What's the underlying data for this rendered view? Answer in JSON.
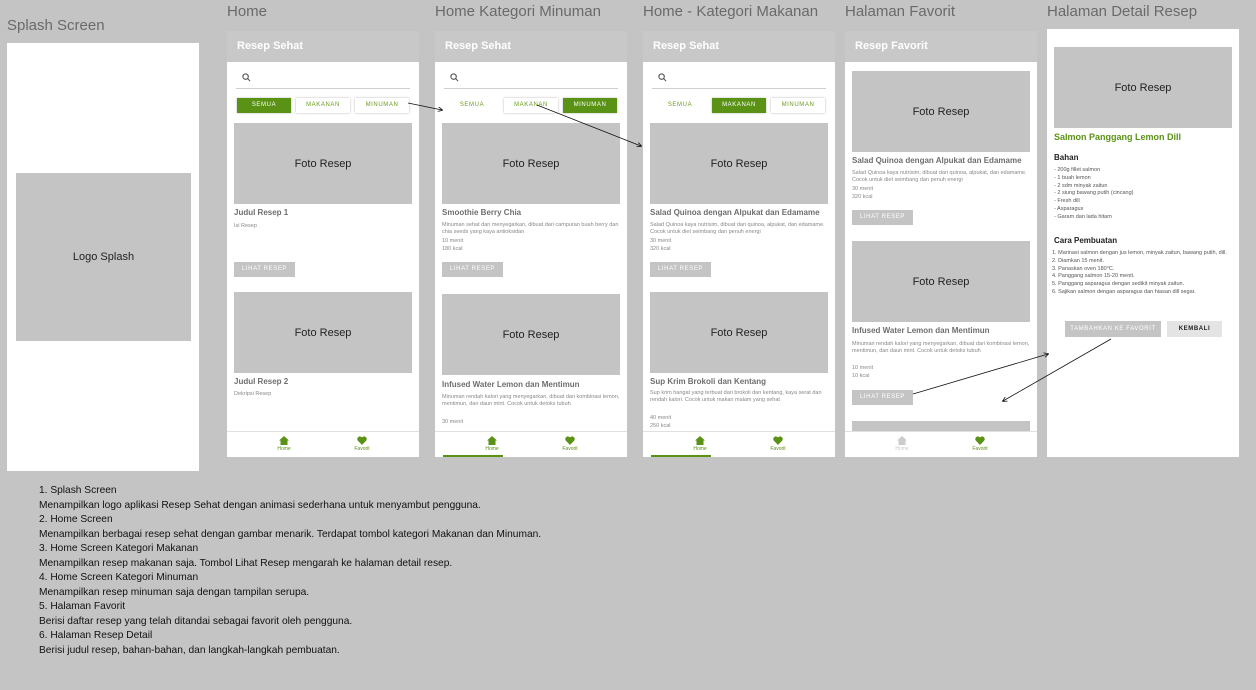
{
  "titles": {
    "splash": "Splash Screen",
    "home": "Home",
    "minuman": "Home Kategori Minuman",
    "makanan": "Home - Kategori Makanan",
    "favorit": "Halaman Favorit",
    "detail": "Halaman Detail Resep"
  },
  "splash": {
    "logo": "Logo Splash"
  },
  "app": {
    "appbar": "Resep Sehat",
    "chips": [
      "SEMUA",
      "MAKANAN",
      "MINUMAN"
    ],
    "nav_home": "Home",
    "nav_fav": "Favorit",
    "photo": "Foto Resep",
    "btn": "LIHAT RESEP"
  },
  "home": {
    "r1_title": "Judul Resep 1",
    "r1_desc": "Isi Resep",
    "r2_title": "Judul Resep 2",
    "r2_desc": "Dekripsi Resep"
  },
  "minuman": {
    "r1_title": "Smoothie Berry Chia",
    "r1_desc": "Minuman sehat dan menyegarkan, dibuat dari campuran buah berry dan chia seeds yang kaya antioksidan",
    "r1_time": "10 menit",
    "r1_kcal": "180 kcal",
    "r2_title": "Infused Water Lemon dan Mentimun",
    "r2_desc": "Minuman rendah kalori yang menyegarkan, dibuat dari kombinasi lemon, mentimun, dan daun mint. Cocok untuk detoks tubuh",
    "r2_time": "30 menit"
  },
  "makanan": {
    "r1_title": "Salad Quinoa dengan Alpukat dan Edamame",
    "r1_desc": "Salad Quinoa kaya nutrisim, dibuat dari quinoa, alpukat, dan edamame. Cocok untuk diet seimbang dan penuh energi",
    "r1_time": "30 menit",
    "r1_kcal": "320 kcal",
    "r2_title": "Sup Krim Brokoli dan Kentang",
    "r2_desc": "Sup krim hangat yang terbuat dari brokoli dan kentang, kaya serat dan rendah kalori. Cocok untuk makan malam yang sehat",
    "r2_time": "40 menit",
    "r2_kcal": "250 kcal"
  },
  "favorit": {
    "appbar": "Resep Favorit",
    "r1_title": "Salad Quinoa dengan Alpukat dan Edamame",
    "r1_desc": "Salad Quinoa kaya nutrisim, dibuat dari quinoa, alpukat, dan edamame. Cocok untuk diet seimbang dan penuh energi",
    "r1_time": "30 menit",
    "r1_kcal": "320 kcal",
    "r2_title": "Infused Water Lemon dan Mentimun",
    "r2_desc": "Minuman rendah kalori yang menyegarkan, dibuat dari kombinasi lemon, mentimun, dan daun mint. Cocok untuk detoks tubuh",
    "r2_time": "10 menit",
    "r2_kcal": "10 kcal"
  },
  "detail": {
    "photo": "Foto Resep",
    "title": "Salmon Panggang Lemon Dill",
    "bahan_h": "Bahan",
    "bahan": [
      "- 200g fillet salmon",
      "- 1 buah lemon",
      "- 2 sdm minyak zaitun",
      "- 2 siung bawang putih (cincang)",
      "- Fresh dill",
      "- Asparagus",
      "- Garam dan lada hitam"
    ],
    "cara_h": "Cara Pembuatan",
    "cara": [
      "1. Marinasi salmon dengan jus lemon, minyak zaitun, bawang putih, dill.",
      "2. Diamkan 15 menit.",
      "3. Panaskan oven 180°C.",
      "4. Panggang salmon 15-20 menit.",
      "5. Panggang asparagus dengan sedikit minyak zaitun.",
      "6. Sajikan salmon dengan asparagus dan hiasan dill segar."
    ],
    "btn_fav": "TAMBAHKAN KE FAVORIT",
    "btn_back": "KEMBALI"
  },
  "notes": [
    "1. Splash Screen",
    "Menampilkan logo aplikasi Resep Sehat dengan animasi sederhana untuk menyambut pengguna.",
    "2. Home Screen",
    "Menampilkan berbagai resep sehat dengan gambar menarik. Terdapat tombol kategori Makanan dan Minuman.",
    "3. Home Screen Kategori Makanan",
    "Menampilkan resep makanan saja. Tombol Lihat Resep mengarah ke halaman detail resep.",
    "4. Home Screen Kategori Minuman",
    "Menampilkan resep minuman saja dengan tampilan serupa.",
    "5. Halaman Favorit",
    "Berisi daftar resep yang telah ditandai sebagai favorit oleh pengguna.",
    "6. Halaman Resep Detail",
    "Berisi judul resep, bahan-bahan, dan langkah-langkah pembuatan."
  ],
  "colors": {
    "accent": "#5a9216",
    "canvas": "#c4c4c4",
    "placeholder": "#c4c4c4"
  }
}
